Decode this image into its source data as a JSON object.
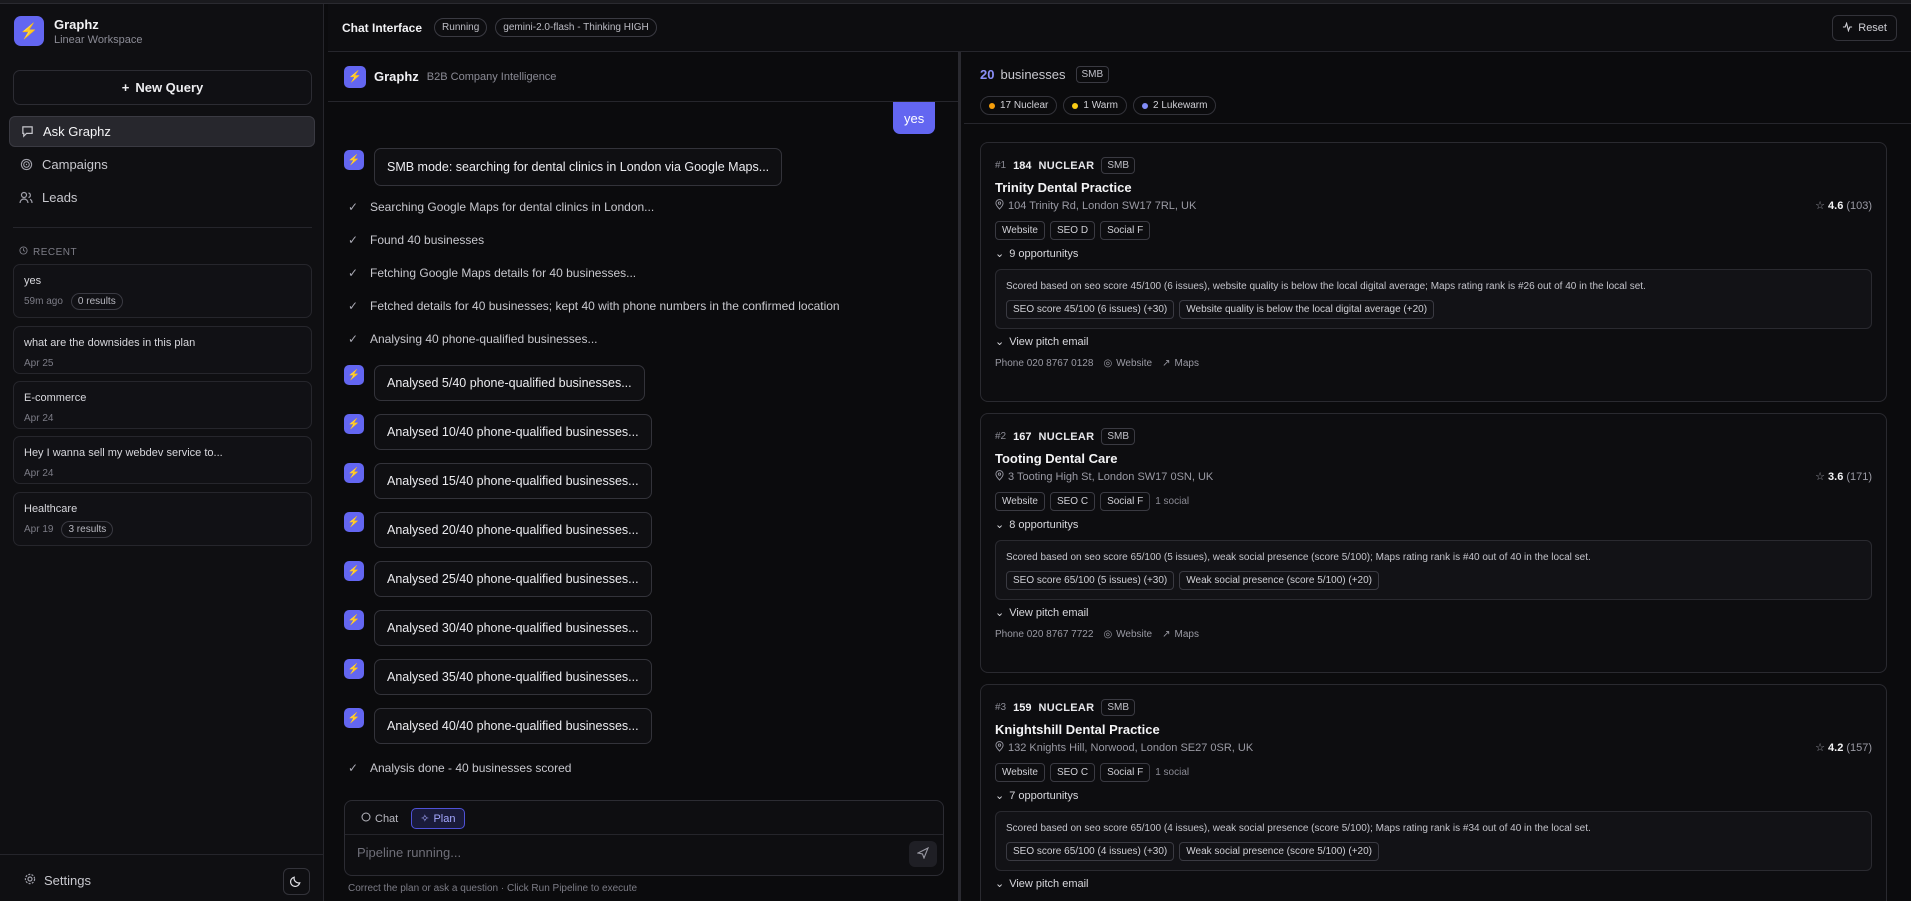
{
  "sidebar": {
    "brand_title": "Graphz",
    "brand_subtitle": "Linear Workspace",
    "new_query": "New Query",
    "nav": [
      {
        "label": "Ask Graphz"
      },
      {
        "label": "Campaigns"
      },
      {
        "label": "Leads"
      }
    ],
    "recent_label": "RECENT",
    "recent": [
      {
        "title": "yes",
        "time": "59m ago",
        "badge": "0 results"
      },
      {
        "title": "what are the downsides in this plan",
        "time": "Apr 25",
        "badge": ""
      },
      {
        "title": "E-commerce",
        "time": "Apr 24",
        "badge": ""
      },
      {
        "title": "Hey I wanna sell my webdev service to...",
        "time": "Apr 24",
        "badge": ""
      },
      {
        "title": "Healthcare",
        "time": "Apr 19",
        "badge": "3 results"
      }
    ],
    "settings": "Settings"
  },
  "header": {
    "title": "Chat Interface",
    "status": "Running",
    "model": "gemini-2.0-flash - Thinking HIGH",
    "reset": "Reset"
  },
  "chat": {
    "title": "Graphz",
    "subtitle": "B2B Company Intelligence",
    "user_message": "yes",
    "smb_message": "SMB mode: searching for dental clinics in London via Google Maps...",
    "steps": [
      "Searching Google Maps for dental clinics in London...",
      "Found 40 businesses",
      "Fetching Google Maps details for 40 businesses...",
      "Fetched details for 40 businesses; kept 40 with phone numbers in the confirmed location",
      "Analysing 40 phone-qualified businesses..."
    ],
    "progress": [
      "Analysed 5/40 phone-qualified businesses...",
      "Analysed 10/40 phone-qualified businesses...",
      "Analysed 15/40 phone-qualified businesses...",
      "Analysed 20/40 phone-qualified businesses...",
      "Analysed 25/40 phone-qualified businesses...",
      "Analysed 30/40 phone-qualified businesses...",
      "Analysed 35/40 phone-qualified businesses...",
      "Analysed 40/40 phone-qualified businesses..."
    ],
    "done": "Analysis done - 40 businesses scored",
    "composer": {
      "tab_chat": "Chat",
      "tab_plan": "Plan",
      "placeholder": "Pipeline running...",
      "hint": "Correct the plan or ask a question · Click Run Pipeline to execute"
    }
  },
  "results": {
    "count": "20",
    "count_label": "businesses",
    "mode": "SMB",
    "temps": [
      {
        "label": "17 Nuclear",
        "color": "#f59e0b"
      },
      {
        "label": "1 Warm",
        "color": "#facc15"
      },
      {
        "label": "2 Lukewarm",
        "color": "#818cf8"
      }
    ],
    "cards": [
      {
        "rank": "#1",
        "score": "184",
        "level": "NUCLEAR",
        "mode": "SMB",
        "name": "Trinity Dental Practice",
        "address": "104 Trinity Rd, London SW17 7RL, UK",
        "rating": "4.6",
        "reviews": "(103)",
        "chips": [
          "Website",
          "SEO D",
          "Social F"
        ],
        "extra": "",
        "opps": "9 opportunitys",
        "detail": "Scored based on seo score 45/100 (6 issues), website quality is below the local digital average; Maps rating rank is #26 out of 40 in the local set.",
        "detail_chips": [
          "SEO score 45/100 (6 issues) (+30)",
          "Website quality is below the local digital average (+20)"
        ],
        "pitch": "View pitch email",
        "phone": "Phone  020 8767 0128",
        "website": "Website",
        "maps": "Maps"
      },
      {
        "rank": "#2",
        "score": "167",
        "level": "NUCLEAR",
        "mode": "SMB",
        "name": "Tooting Dental Care",
        "address": "3 Tooting High St, London SW17 0SN, UK",
        "rating": "3.6",
        "reviews": "(171)",
        "chips": [
          "Website",
          "SEO C",
          "Social F"
        ],
        "extra": "1 social",
        "opps": "8 opportunitys",
        "detail": "Scored based on seo score 65/100 (5 issues), weak social presence (score 5/100); Maps rating rank is #40 out of 40 in the local set.",
        "detail_chips": [
          "SEO score 65/100 (5 issues) (+30)",
          "Weak social presence (score 5/100) (+20)"
        ],
        "pitch": "View pitch email",
        "phone": "Phone  020 8767 7722",
        "website": "Website",
        "maps": "Maps"
      },
      {
        "rank": "#3",
        "score": "159",
        "level": "NUCLEAR",
        "mode": "SMB",
        "name": "Knightshill Dental Practice",
        "address": "132 Knights Hill, Norwood, London SE27 0SR, UK",
        "rating": "4.2",
        "reviews": "(157)",
        "chips": [
          "Website",
          "SEO C",
          "Social F"
        ],
        "extra": "1 social",
        "opps": "7 opportunitys",
        "detail": "Scored based on seo score 65/100 (4 issues), weak social presence (score 5/100); Maps rating rank is #34 out of 40 in the local set.",
        "detail_chips": [
          "SEO score 65/100 (4 issues) (+30)",
          "Weak social presence (score 5/100) (+20)"
        ],
        "pitch": "View pitch email",
        "phone": "",
        "website": "",
        "maps": ""
      }
    ]
  }
}
